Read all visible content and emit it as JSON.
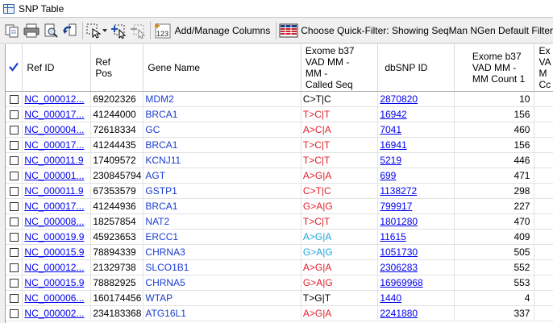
{
  "window": {
    "title": "SNP Table"
  },
  "toolbar": {
    "add_manage_columns": "Add/Manage Columns",
    "quick_filter": "Choose Quick-Filter: Showing SeqMan NGen Default Filter"
  },
  "table": {
    "headers": {
      "ref_id": "Ref ID",
      "ref_pos": [
        "Ref",
        "Pos"
      ],
      "gene_name": "Gene Name",
      "called_seq": [
        "Exome b37",
        "VAD MM -",
        "MM -",
        "Called Seq"
      ],
      "dbsnp": "dbSNP ID",
      "mm_count": [
        "Exome b37",
        "VAD MM -",
        "MM Count 1"
      ],
      "next": [
        "Ex",
        "VA",
        "M",
        "Cc"
      ]
    },
    "rows": [
      {
        "ref_id": "NC_000012...",
        "pos": "69202326",
        "gene": "MDM2",
        "seq": "C>T|C",
        "seq_color": "black",
        "dbsnp": "2870820",
        "count": "10"
      },
      {
        "ref_id": "NC_000017...",
        "pos": "41244000",
        "gene": "BRCA1",
        "seq": "T>C|T",
        "seq_color": "red",
        "dbsnp": "16942",
        "count": "156"
      },
      {
        "ref_id": "NC_000004...",
        "pos": "72618334",
        "gene": "GC",
        "seq": "A>C|A",
        "seq_color": "red",
        "dbsnp": "7041",
        "count": "460"
      },
      {
        "ref_id": "NC_000017...",
        "pos": "41244435",
        "gene": "BRCA1",
        "seq": "T>C|T",
        "seq_color": "red",
        "dbsnp": "16941",
        "count": "156"
      },
      {
        "ref_id": "NC_000011.9",
        "pos": "17409572",
        "gene": "KCNJ11",
        "seq": "T>C|T",
        "seq_color": "red",
        "dbsnp": "5219",
        "count": "446"
      },
      {
        "ref_id": "NC_000001...",
        "pos": "230845794",
        "gene": "AGT",
        "seq": "A>G|A",
        "seq_color": "red",
        "dbsnp": "699",
        "count": "471"
      },
      {
        "ref_id": "NC_000011.9",
        "pos": "67353579",
        "gene": "GSTP1",
        "seq": "C>T|C",
        "seq_color": "red",
        "dbsnp": "1138272",
        "count": "298"
      },
      {
        "ref_id": "NC_000017...",
        "pos": "41244936",
        "gene": "BRCA1",
        "seq": "G>A|G",
        "seq_color": "red",
        "dbsnp": "799917",
        "count": "227"
      },
      {
        "ref_id": "NC_000008...",
        "pos": "18257854",
        "gene": "NAT2",
        "seq": "T>C|T",
        "seq_color": "red",
        "dbsnp": "1801280",
        "count": "470"
      },
      {
        "ref_id": "NC_000019.9",
        "pos": "45923653",
        "gene": "ERCC1",
        "seq": "A>G|A",
        "seq_color": "cyan",
        "dbsnp": "11615",
        "count": "409"
      },
      {
        "ref_id": "NC_000015.9",
        "pos": "78894339",
        "gene": "CHRNA3",
        "seq": "G>A|G",
        "seq_color": "cyan",
        "dbsnp": "1051730",
        "count": "505"
      },
      {
        "ref_id": "NC_000012...",
        "pos": "21329738",
        "gene": "SLCO1B1",
        "seq": "A>G|A",
        "seq_color": "red",
        "dbsnp": "2306283",
        "count": "552"
      },
      {
        "ref_id": "NC_000015.9",
        "pos": "78882925",
        "gene": "CHRNA5",
        "seq": "G>A|G",
        "seq_color": "red",
        "dbsnp": "16969968",
        "count": "553"
      },
      {
        "ref_id": "NC_000006...",
        "pos": "160174456",
        "gene": "WTAP",
        "seq": "T>G|T",
        "seq_color": "black",
        "dbsnp": "1440",
        "count": "4"
      },
      {
        "ref_id": "NC_000002...",
        "pos": "234183368",
        "gene": "ATG16L1",
        "seq": "A>G|A",
        "seq_color": "red",
        "dbsnp": "2241880",
        "count": "337"
      }
    ]
  }
}
